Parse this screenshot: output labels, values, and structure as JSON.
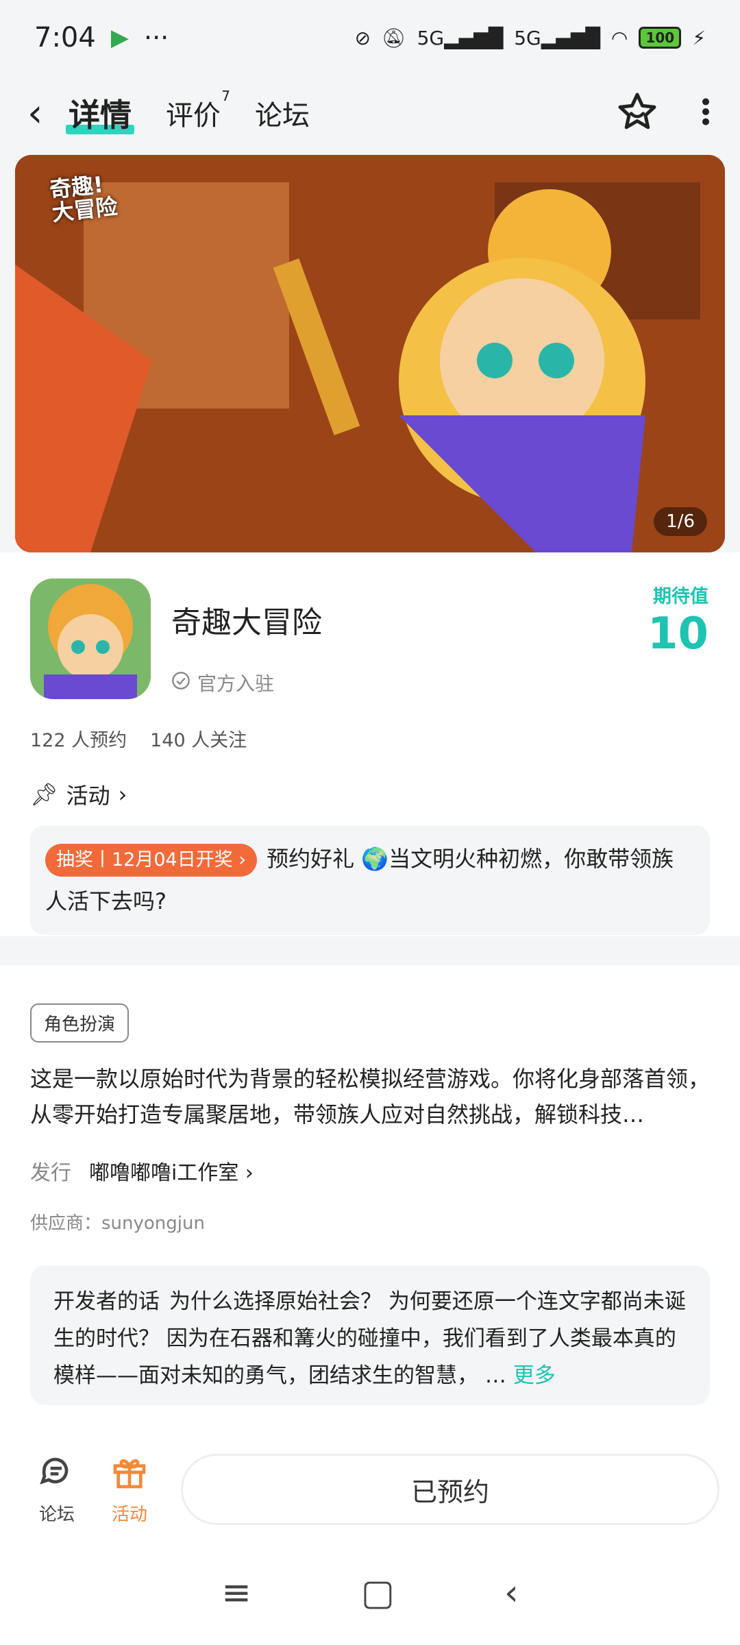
{
  "status": {
    "time": "7:04",
    "battery": "100",
    "signal1": "5G",
    "signal2": "5G"
  },
  "nav": {
    "tabs": [
      {
        "label": "详情"
      },
      {
        "label": "评价",
        "badge": "7"
      },
      {
        "label": "论坛"
      }
    ]
  },
  "banner": {
    "counter": "1/6",
    "logo_text": "奇趣!大冒险"
  },
  "app": {
    "name": "奇趣大冒险",
    "official": "官方入驻",
    "expect_label": "期待值",
    "expect_value": "10",
    "reservations": "122 人预约",
    "followers": "140 人关注"
  },
  "activity": {
    "heading": "活动",
    "tag": "抽奖丨12月04日开奖",
    "text": "预约好礼 🌍当文明火种初燃，你敢带领族人活下去吗?"
  },
  "details": {
    "genre": "角色扮演",
    "description": "这是一款以原始时代为背景的轻松模拟经营游戏。你将化身部落首领，从零开始打造专属聚居地，带领族人应对自然挑战，解锁科技…",
    "publisher_label": "发行",
    "publisher": "嘟噜嘟噜i工作室",
    "supplier": "供应商：sunyongjun",
    "dev_title": "开发者的话",
    "dev_text": "为什么选择原始社会？ 为何要还原一个连文字都尚未诞生的时代？ 因为在石器和篝火的碰撞中，我们看到了人类最本真的模样——面对未知的勇气，团结求生的智慧， …",
    "more": "更多"
  },
  "bottom": {
    "forum": "论坛",
    "activity": "活动",
    "reserve": "已预约"
  },
  "colors": {
    "accent": "#1fc3b2",
    "orange": "#f26a3a",
    "tab_underline": "#2dd4bf"
  }
}
